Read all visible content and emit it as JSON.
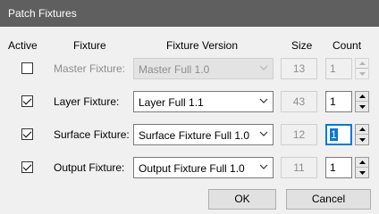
{
  "window": {
    "title": "Patch Fixtures"
  },
  "headers": {
    "active": "Active",
    "fixture": "Fixture",
    "fixture_version": "Fixture Version",
    "size": "Size",
    "count": "Count"
  },
  "rows": [
    {
      "label": "Master Fixture:",
      "active": false,
      "enabled": false,
      "version": "Master Full 1.0",
      "size": "13",
      "count": "1"
    },
    {
      "label": "Layer Fixture:",
      "active": true,
      "enabled": true,
      "version": "Layer Full 1.1",
      "size": "43",
      "count": "1"
    },
    {
      "label": "Surface Fixture:",
      "active": true,
      "enabled": true,
      "version": "Surface Fixture Full 1.0",
      "size": "12",
      "count": "1"
    },
    {
      "label": "Output Fixture:",
      "active": true,
      "enabled": true,
      "version": "Output Fixture Full 1.0",
      "size": "11",
      "count": "1"
    }
  ],
  "buttons": {
    "ok": "OK",
    "cancel": "Cancel"
  },
  "colors": {
    "titlebar": "#5f5f5f",
    "focus": "#0078d7"
  }
}
